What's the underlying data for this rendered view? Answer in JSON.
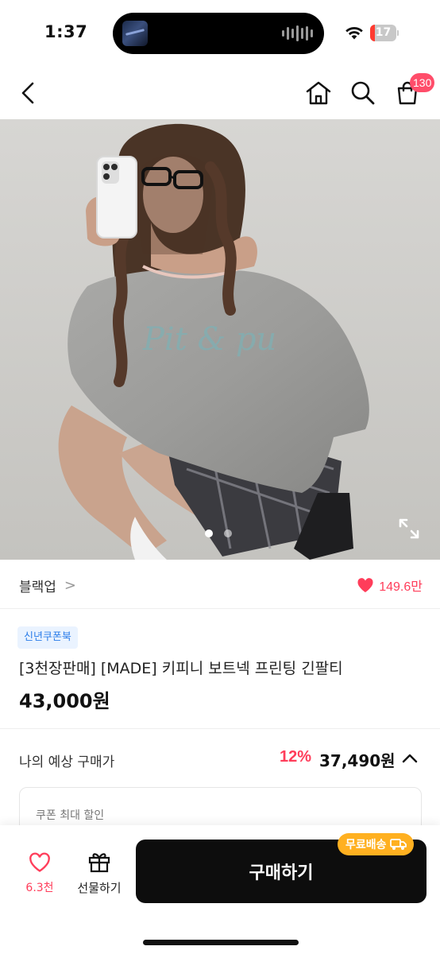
{
  "status_bar": {
    "time": "1:37",
    "battery": "17",
    "battery_level": 0.17,
    "icons": [
      "wifi-icon",
      "battery-icon"
    ]
  },
  "nav": {
    "icons": [
      "chevron-left-icon",
      "home-icon",
      "search-icon",
      "shopping-bag-icon"
    ],
    "cart_count": "130"
  },
  "hero": {
    "print_text": "Pit & pu",
    "slide_count": 2,
    "active_slide": 1,
    "icons": [
      "expand-icon"
    ]
  },
  "brand": {
    "name": "블랙업",
    "chevron": ">",
    "likes": "149.6만"
  },
  "product": {
    "coupon_tag": "신년쿠폰북",
    "title": "[3천장판매] [MADE] 키피니 보트넥 프린팅 긴팔티",
    "price": "43,000원"
  },
  "estimate": {
    "label": "나의 예상 구매가",
    "discount_rate": "12%",
    "price": "37,490원",
    "icons": [
      "chevron-up-icon"
    ]
  },
  "coupon_card": {
    "label": "쿠폰 최대 할인"
  },
  "bottom_bar": {
    "wish_count": "6.3천",
    "gift_label": "선물하기",
    "buy_label": "구매하기",
    "free_shipping": "무료배송",
    "icons": [
      "heart-icon",
      "gift-icon",
      "truck-icon"
    ]
  },
  "colors": {
    "accent": "#ff3d5a",
    "coupon_blue": "#2b7de9",
    "free_ship": "#ffb020",
    "buy_button": "#0d0d0d"
  }
}
